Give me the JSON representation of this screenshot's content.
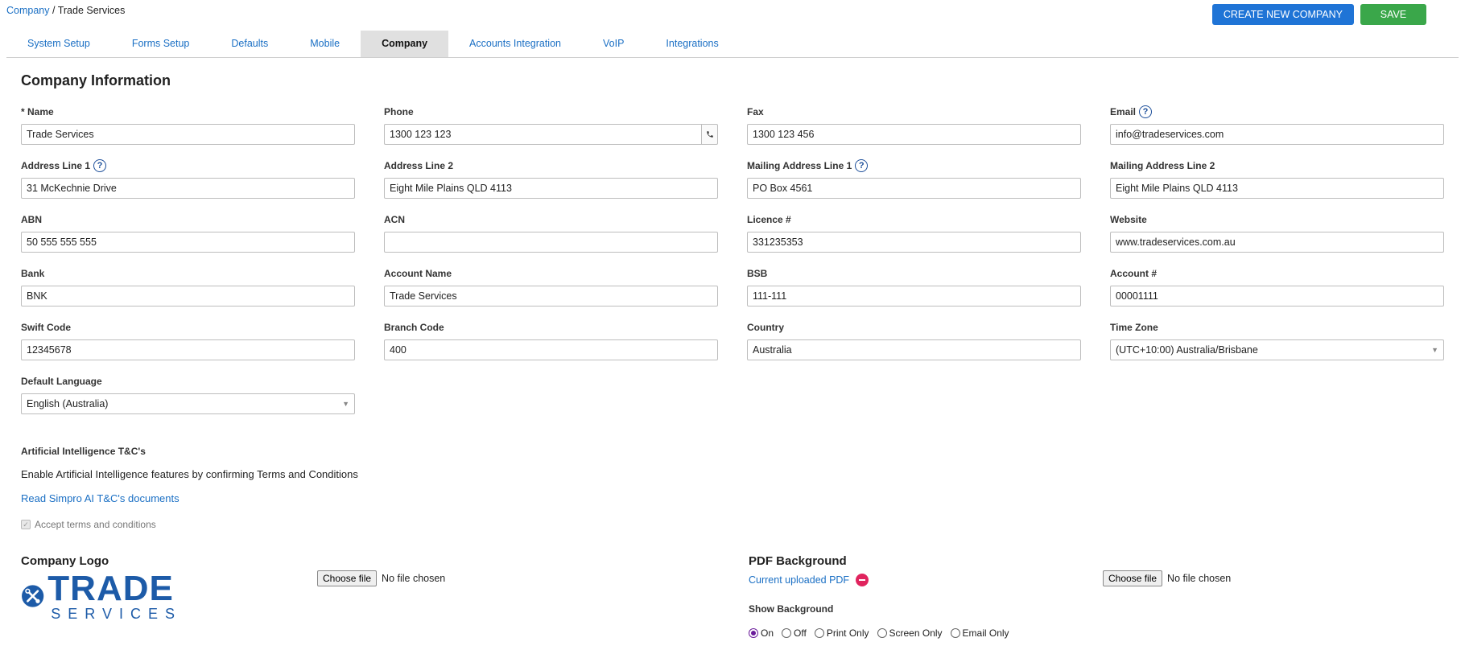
{
  "breadcrumb": {
    "root": "Company",
    "sep": "/",
    "current": "Trade Services"
  },
  "actions": {
    "create_label": "CREATE NEW COMPANY",
    "save_label": "SAVE"
  },
  "tabs": [
    "System Setup",
    "Forms Setup",
    "Defaults",
    "Mobile",
    "Company",
    "Accounts Integration",
    "VoIP",
    "Integrations"
  ],
  "active_tab": "Company",
  "section_title": "Company Information",
  "fields": {
    "name": {
      "label": "* Name",
      "value": "Trade Services"
    },
    "phone": {
      "label": "Phone",
      "value": "1300 123 123"
    },
    "fax": {
      "label": "Fax",
      "value": "1300 123 456"
    },
    "email": {
      "label": "Email",
      "value": "info@tradeservices.com"
    },
    "address1": {
      "label": "Address Line 1",
      "value": "31 McKechnie Drive"
    },
    "address2": {
      "label": "Address Line 2",
      "value": "Eight Mile Plains QLD 4113"
    },
    "mailing1": {
      "label": "Mailing Address Line 1",
      "value": "PO Box 4561"
    },
    "mailing2": {
      "label": "Mailing Address Line 2",
      "value": "Eight Mile Plains QLD 4113"
    },
    "abn": {
      "label": "ABN",
      "value": "50 555 555 555"
    },
    "acn": {
      "label": "ACN",
      "value": ""
    },
    "licence": {
      "label": "Licence #",
      "value": "331235353"
    },
    "website": {
      "label": "Website",
      "value": "www.tradeservices.com.au"
    },
    "bank": {
      "label": "Bank",
      "value": "BNK"
    },
    "account_name": {
      "label": "Account Name",
      "value": "Trade Services"
    },
    "bsb": {
      "label": "BSB",
      "value": "111-111"
    },
    "account_no": {
      "label": "Account #",
      "value": "00001111"
    },
    "swift": {
      "label": "Swift Code",
      "value": "12345678"
    },
    "branch": {
      "label": "Branch Code",
      "value": "400"
    },
    "country": {
      "label": "Country",
      "value": "Australia"
    },
    "timezone": {
      "label": "Time Zone",
      "value": "(UTC+10:00) Australia/Brisbane"
    },
    "language": {
      "label": "Default Language",
      "value": "English (Australia)"
    }
  },
  "help_glyph": "?",
  "ai": {
    "title": "Artificial Intelligence T&C's",
    "description": "Enable Artificial Intelligence features by confirming Terms and Conditions",
    "link": "Read Simpro AI T&C's documents",
    "accept": "Accept terms and conditions",
    "accepted": true
  },
  "logo_section": {
    "title": "Company Logo",
    "choose_label": "Choose file",
    "no_file": "No file chosen"
  },
  "pdf_section": {
    "title": "PDF Background",
    "current_link": "Current uploaded PDF",
    "choose_label": "Choose file",
    "no_file": "No file chosen",
    "show_label": "Show Background",
    "options": [
      "On",
      "Off",
      "Print Only",
      "Screen Only",
      "Email Only"
    ],
    "selected": "On"
  },
  "colors": {
    "primary_blue": "#1f74d6",
    "save_green": "#3aa74a",
    "logo_blue": "#1d5ba8",
    "remove_red": "#e0245e",
    "radio_purple": "#6a1b9a"
  },
  "icons": {
    "phone": "phone-icon",
    "help": "help-icon",
    "remove": "remove-icon",
    "dropdown": "chevron-down-icon"
  }
}
